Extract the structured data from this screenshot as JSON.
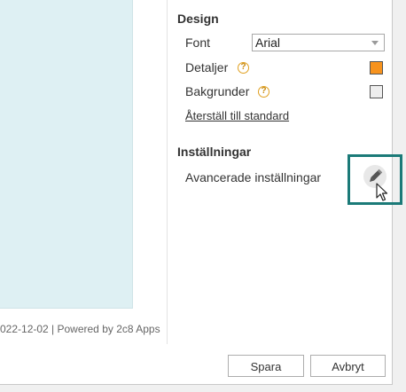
{
  "footer": {
    "text": "022-12-02 | Powered by 2c8 Apps"
  },
  "design": {
    "title": "Design",
    "font_label": "Font",
    "font_value": "Arial",
    "details_label": "Detaljer",
    "details_color": "#f7931e",
    "background_label": "Bakgrunder",
    "background_color": "#eeeeee",
    "reset_link": "Återställ till standard",
    "help_glyph": "?"
  },
  "settings": {
    "title": "Inställningar",
    "advanced_label": "Avancerade inställningar",
    "highlight_color": "#1b7a78"
  },
  "buttons": {
    "save": "Spara",
    "cancel": "Avbryt"
  },
  "icons": {
    "help": "help-icon",
    "edit": "pencil-icon",
    "cursor": "cursor-icon",
    "dropdown": "chevron-down-icon"
  }
}
